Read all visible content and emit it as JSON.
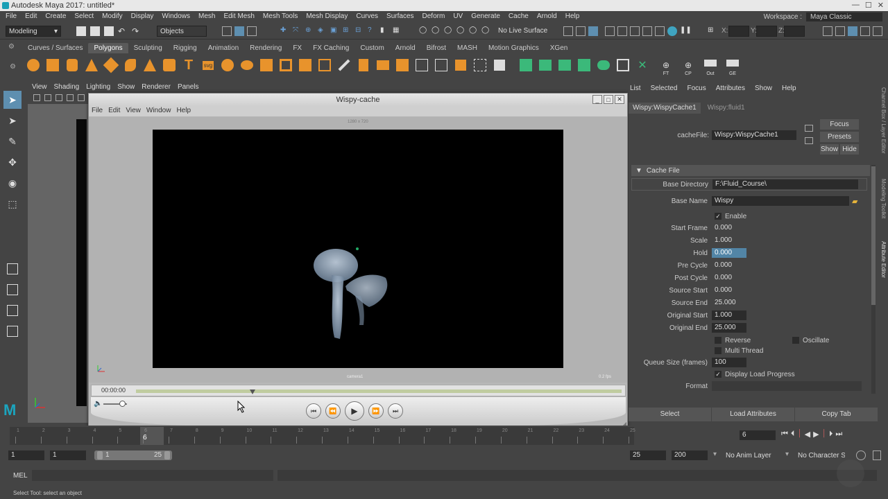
{
  "window": {
    "title": "Autodesk Maya 2017: untitled*"
  },
  "menubar": {
    "items": [
      "File",
      "Edit",
      "Create",
      "Select",
      "Modify",
      "Display",
      "Windows",
      "Mesh",
      "Edit Mesh",
      "Mesh Tools",
      "Mesh Display",
      "Curves",
      "Surfaces",
      "Deform",
      "UV",
      "Generate",
      "Cache",
      "Arnold",
      "Help"
    ],
    "workspace_label": "Workspace :",
    "workspace_value": "Maya Classic"
  },
  "statusline": {
    "menuset": "Modeling",
    "selection_mode": "Objects",
    "live_surface": "No Live Surface",
    "x_label": "X:",
    "y_label": "Y:",
    "z_label": "Z:"
  },
  "shelf": {
    "tabs": [
      "Curves / Surfaces",
      "Polygons",
      "Sculpting",
      "Rigging",
      "Animation",
      "Rendering",
      "FX",
      "FX Caching",
      "Custom",
      "Arnold",
      "Bifrost",
      "MASH",
      "Motion Graphics",
      "XGen"
    ],
    "active_tab": "Polygons",
    "icon_labels": [
      "FT",
      "CP",
      "Out",
      "GE"
    ]
  },
  "viewport": {
    "menu": [
      "View",
      "Shading",
      "Lighting",
      "Show",
      "Renderer",
      "Panels"
    ]
  },
  "player": {
    "title": "Wispy-cache",
    "menu": [
      "File",
      "Edit",
      "View",
      "Window",
      "Help"
    ],
    "resolution": "1280 x 720",
    "camera": "camera1",
    "fps": "0.2 fps",
    "time": "00:00:00",
    "progress": 0.24,
    "volume": 0.8
  },
  "attribute_editor": {
    "menu": [
      "List",
      "Selected",
      "Focus",
      "Attributes",
      "Show",
      "Help"
    ],
    "tabs": [
      "Wispy:WispyCache1",
      "Wispy:fluid1"
    ],
    "cachefile_label": "cacheFile:",
    "cachefile_value": "Wispy:WispyCache1",
    "buttons": {
      "focus": "Focus",
      "presets": "Presets",
      "show": "Show",
      "hide": "Hide"
    },
    "section": "Cache File",
    "base_directory_label": "Base Directory",
    "base_directory_value": "F:\\Fluid_Course\\",
    "base_name_label": "Base Name",
    "base_name_value": "Wispy",
    "enable_label": "Enable",
    "fields": [
      {
        "label": "Start Frame",
        "value": "0.000"
      },
      {
        "label": "Scale",
        "value": "1.000"
      },
      {
        "label": "Hold",
        "value": "0.000"
      },
      {
        "label": "Pre Cycle",
        "value": "0.000"
      },
      {
        "label": "Post Cycle",
        "value": "0.000"
      },
      {
        "label": "Source Start",
        "value": "0.000"
      },
      {
        "label": "Source End",
        "value": "25.000"
      },
      {
        "label": "Original Start",
        "value": "1.000"
      },
      {
        "label": "Original End",
        "value": "25.000"
      }
    ],
    "reverse_label": "Reverse",
    "oscillate_label": "Oscillate",
    "multi_thread_label": "Multi Thread",
    "queue_label": "Queue Size (frames)",
    "queue_value": "100",
    "display_progress_label": "Display Load Progress",
    "format_label": "Format",
    "bottom_buttons": [
      "Select",
      "Load Attributes",
      "Copy Tab"
    ],
    "side_tabs": [
      "Channel Box / Layer Editor",
      "Modeling Toolkit",
      "Attribute Editor"
    ]
  },
  "timeline": {
    "ticks": [
      "1",
      "2",
      "3",
      "4",
      "5",
      "6",
      "7",
      "8",
      "9",
      "10",
      "11",
      "12",
      "13",
      "14",
      "15",
      "16",
      "17",
      "18",
      "19",
      "20",
      "21",
      "22",
      "23",
      "24",
      "25"
    ],
    "current_frame": "6",
    "current_frame_field": "6"
  },
  "range": {
    "start": "1",
    "playback_start": "1",
    "slider_start": "1",
    "slider_end": "25",
    "playback_end": "25",
    "end": "200",
    "anim_layer": "No Anim Layer",
    "char_set": "No Character Set"
  },
  "mel": {
    "label": "MEL"
  },
  "help": {
    "text": "Select Tool: select an object"
  }
}
